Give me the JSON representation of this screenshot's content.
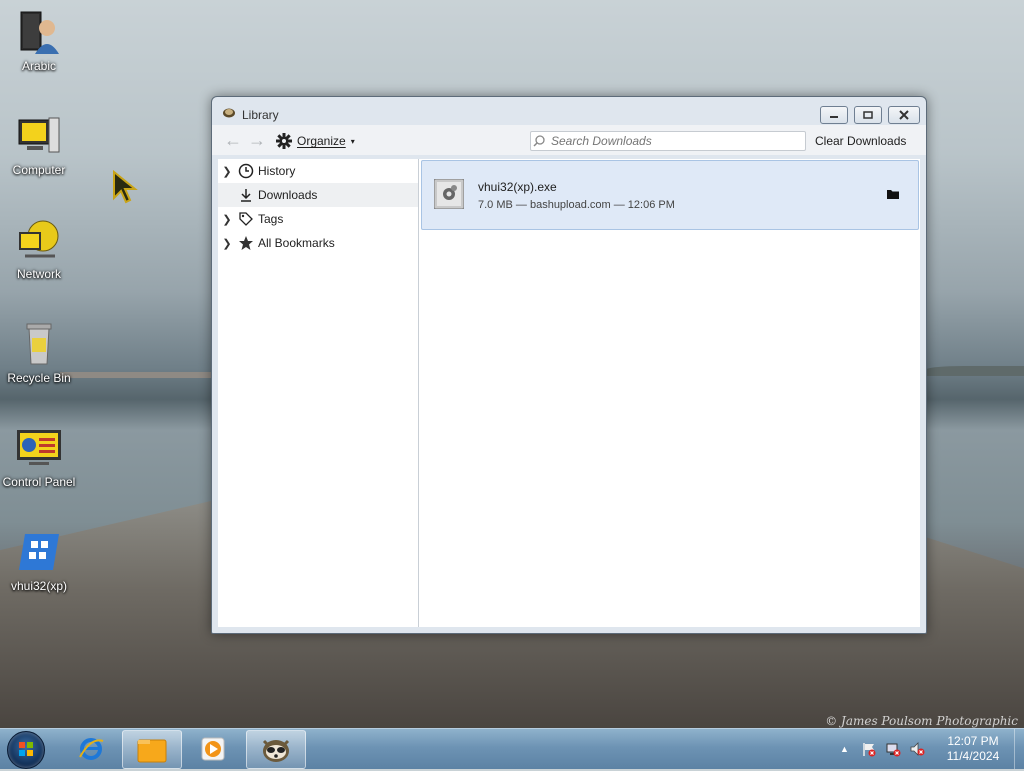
{
  "desktop": {
    "icons": [
      {
        "label": "Arabic"
      },
      {
        "label": "Computer"
      },
      {
        "label": "Network"
      },
      {
        "label": "Recycle Bin"
      },
      {
        "label": "Control Panel"
      },
      {
        "label": "vhui32(xp)"
      }
    ],
    "watermark": "© James Poulsom Photographic"
  },
  "window": {
    "title": "Library",
    "toolbar": {
      "organize_label": "Organize",
      "search_placeholder": "Search Downloads",
      "clear_label": "Clear Downloads"
    },
    "sidebar": {
      "items": [
        {
          "label": "History",
          "icon": "clock-icon",
          "expandable": true
        },
        {
          "label": "Downloads",
          "icon": "download-arrow-icon",
          "expandable": false,
          "selected": true
        },
        {
          "label": "Tags",
          "icon": "tag-icon",
          "expandable": true
        },
        {
          "label": "All Bookmarks",
          "icon": "star-icon",
          "expandable": true
        }
      ]
    },
    "downloads": [
      {
        "name": "vhui32(xp).exe",
        "meta": "7.0 MB — bashupload.com — 12:06 PM"
      }
    ]
  },
  "taskbar": {
    "clock_time": "12:07 PM",
    "clock_date": "11/4/2024"
  },
  "colors": {
    "selection_bg": "#dfe9f7",
    "selection_border": "#a9c4e4",
    "taskbar": "#6d93b4"
  }
}
